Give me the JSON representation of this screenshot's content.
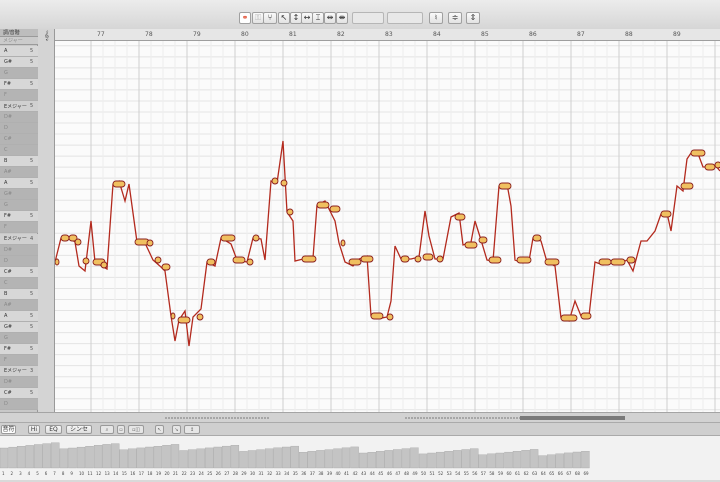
{
  "toolbar": {
    "buttons": [
      {
        "icon": "link-icon",
        "glyph": "⚭"
      },
      {
        "icon": "lock-icon",
        "glyph": "⚿"
      },
      {
        "icon": "tuning-fork-icon",
        "glyph": "⑂"
      },
      {
        "icon": "pointer-icon",
        "glyph": "↖"
      },
      {
        "icon": "pitch-tool-icon",
        "glyph": "↕"
      },
      {
        "icon": "time-tool-icon",
        "glyph": "↔"
      },
      {
        "icon": "amplitude-tool-icon",
        "glyph": "⌶"
      },
      {
        "icon": "separation-tool-icon",
        "glyph": "⇹"
      },
      {
        "icon": "scissor-tool-icon",
        "glyph": "⇼"
      },
      {
        "icon": "pitch-macro-icon",
        "glyph": "♮"
      },
      {
        "icon": "quantize-icon",
        "glyph": "≑"
      },
      {
        "icon": "snap-icon",
        "glyph": "⇕"
      }
    ]
  },
  "sidebar": {
    "header_label": "調/音階",
    "subheader_label": "メジャー",
    "rows": [
      {
        "label": "A",
        "num": "5",
        "kind": "light"
      },
      {
        "label": "G#",
        "num": "5",
        "kind": "light"
      },
      {
        "label": "G",
        "num": "",
        "kind": "dark"
      },
      {
        "label": "F#",
        "num": "5",
        "kind": "light"
      },
      {
        "label": "F",
        "num": "",
        "kind": "dark"
      },
      {
        "label": "Eメジャー",
        "num": "5",
        "kind": "scale"
      },
      {
        "label": "D#",
        "num": "",
        "kind": "dark"
      },
      {
        "label": "D",
        "num": "",
        "kind": "dark"
      },
      {
        "label": "C#",
        "num": "",
        "kind": "dark"
      },
      {
        "label": "C",
        "num": "",
        "kind": "dark"
      },
      {
        "label": "B",
        "num": "5",
        "kind": "light"
      },
      {
        "label": "A#",
        "num": "",
        "kind": "dark"
      },
      {
        "label": "A",
        "num": "5",
        "kind": "light"
      },
      {
        "label": "G#",
        "num": "",
        "kind": "dark"
      },
      {
        "label": "G",
        "num": "",
        "kind": "dark"
      },
      {
        "label": "F#",
        "num": "5",
        "kind": "light"
      },
      {
        "label": "F",
        "num": "",
        "kind": "dark"
      },
      {
        "label": "Eメジャー",
        "num": "4",
        "kind": "scale"
      },
      {
        "label": "D#",
        "num": "",
        "kind": "dark"
      },
      {
        "label": "D",
        "num": "",
        "kind": "dark"
      },
      {
        "label": "C#",
        "num": "5",
        "kind": "light"
      },
      {
        "label": "C",
        "num": "",
        "kind": "dark"
      },
      {
        "label": "B",
        "num": "5",
        "kind": "light"
      },
      {
        "label": "A#",
        "num": "",
        "kind": "dark"
      },
      {
        "label": "A",
        "num": "5",
        "kind": "light"
      },
      {
        "label": "G#",
        "num": "5",
        "kind": "light"
      },
      {
        "label": "G",
        "num": "",
        "kind": "dark"
      },
      {
        "label": "F#",
        "num": "5",
        "kind": "light"
      },
      {
        "label": "F",
        "num": "",
        "kind": "dark"
      },
      {
        "label": "Eメジャー",
        "num": "3",
        "kind": "scale"
      },
      {
        "label": "D#",
        "num": "",
        "kind": "dark"
      },
      {
        "label": "C#",
        "num": "5",
        "kind": "light"
      },
      {
        "label": "D",
        "num": "",
        "kind": "dark"
      }
    ]
  },
  "ruler": {
    "bars": [
      "77",
      "78",
      "79",
      "80",
      "81",
      "82",
      "83",
      "84",
      "85",
      "86",
      "87",
      "88",
      "89"
    ]
  },
  "tabs": {
    "items": [
      {
        "label": "音符"
      },
      {
        "label": "Hi"
      },
      {
        "label": "EQ"
      },
      {
        "label": "シンセ"
      }
    ]
  },
  "overview": {
    "labels": [
      "1",
      "2",
      "3",
      "4",
      "5",
      "6",
      "7",
      "8",
      "9",
      "10",
      "11",
      "12",
      "13",
      "14",
      "15",
      "16",
      "17",
      "18",
      "19",
      "20",
      "21",
      "22",
      "23",
      "24",
      "25",
      "26",
      "27",
      "28",
      "29",
      "30",
      "31",
      "32",
      "33",
      "34",
      "35",
      "36",
      "37",
      "38",
      "39",
      "40",
      "41",
      "42",
      "43",
      "44",
      "45",
      "46",
      "47",
      "48",
      "49",
      "50",
      "51",
      "52",
      "53",
      "54",
      "55",
      "56",
      "57",
      "58",
      "59",
      "60",
      "61",
      "62",
      "63",
      "64",
      "65",
      "66",
      "67",
      "68",
      "69"
    ]
  },
  "colors": {
    "blob_fill": "#f0c060",
    "blob_stroke": "#8a1f1f",
    "pitch_line": "#b32a1e",
    "grid_line": "#e4e4e4",
    "grid_bar_line": "#cfcfcf"
  }
}
